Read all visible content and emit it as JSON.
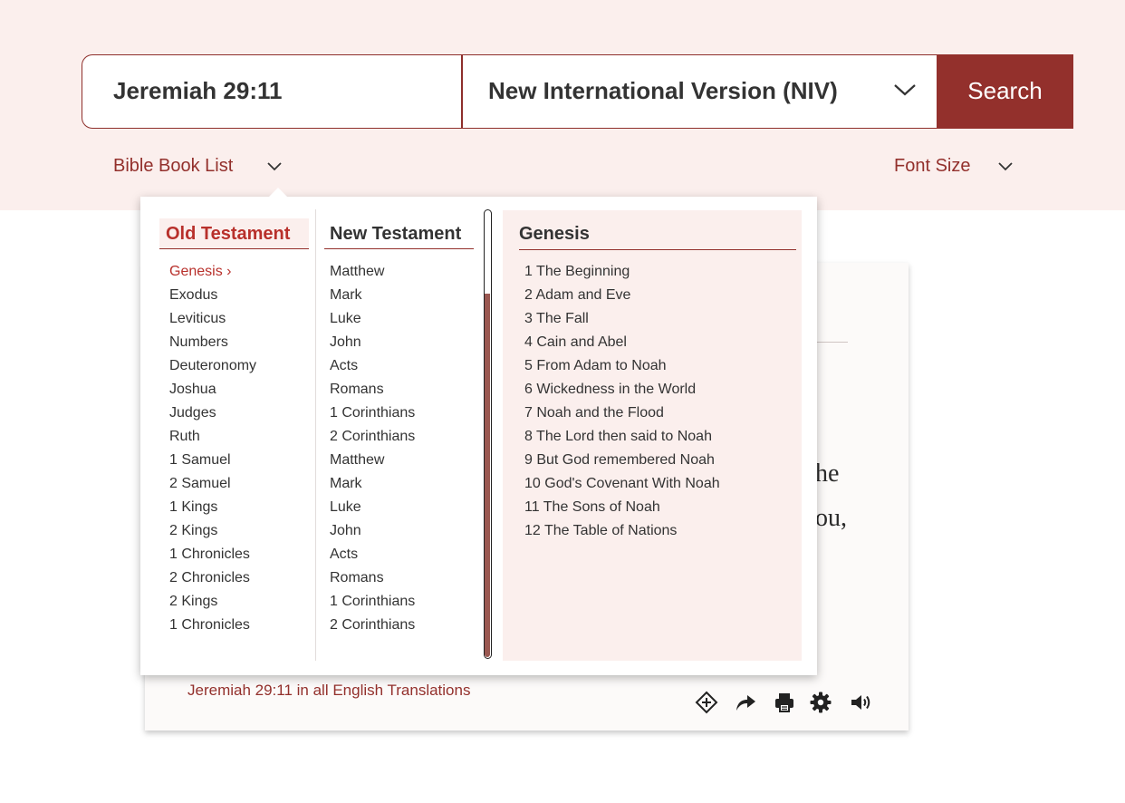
{
  "search": {
    "query_value": "Jeremiah 29:11",
    "version_selected": "New International Version (NIV)",
    "button_label": "Search"
  },
  "toolbar": {
    "book_list_label": "Bible Book List",
    "font_size_label": "Font Size"
  },
  "dropdown": {
    "old_testament_label": "Old Testament",
    "new_testament_label": "New Testament",
    "old_testament_books": [
      "Genesis ›",
      "Exodus",
      "Leviticus",
      "Numbers",
      "Deuteronomy",
      "Joshua",
      "Judges",
      "Ruth",
      "1 Samuel",
      "2 Samuel",
      "1 Kings",
      "2 Kings",
      "1 Chronicles",
      "2 Chronicles",
      "2 Kings",
      "1 Chronicles"
    ],
    "new_testament_books": [
      "Matthew",
      "Mark",
      "Luke",
      "John",
      "Acts",
      "Romans",
      "1 Corinthians",
      "2 Corinthians",
      "Matthew",
      "Mark",
      "Luke",
      "John",
      "Acts",
      "Romans",
      "1 Corinthians",
      "2 Corinthians"
    ],
    "selected_book": "Genesis",
    "chapters": [
      "1 The Beginning",
      "2 Adam and Eve",
      "3 The Fall",
      "4 Cain and Abel",
      "5 From Adam to Noah",
      "6 Wickedness in the World",
      "7 Noah and the Flood",
      "8 The Lord then said to Noah",
      "9 But God remembered Noah",
      "10 God's Covenant With Noah",
      "11 The Sons of Noah",
      "12 The Table of Nations"
    ]
  },
  "passage": {
    "fragment_1": "he",
    "fragment_2": "ou,",
    "all_translations_link": "Jeremiah 29:11 in all English Translations",
    "icons": [
      "add-compass-icon",
      "share-icon",
      "print-icon",
      "settings-icon",
      "audio-icon"
    ]
  },
  "colors": {
    "accent": "#93302c",
    "accent_text": "#b8302b",
    "band_background": "#fbefed",
    "scroll_thumb": "#9a5851"
  }
}
